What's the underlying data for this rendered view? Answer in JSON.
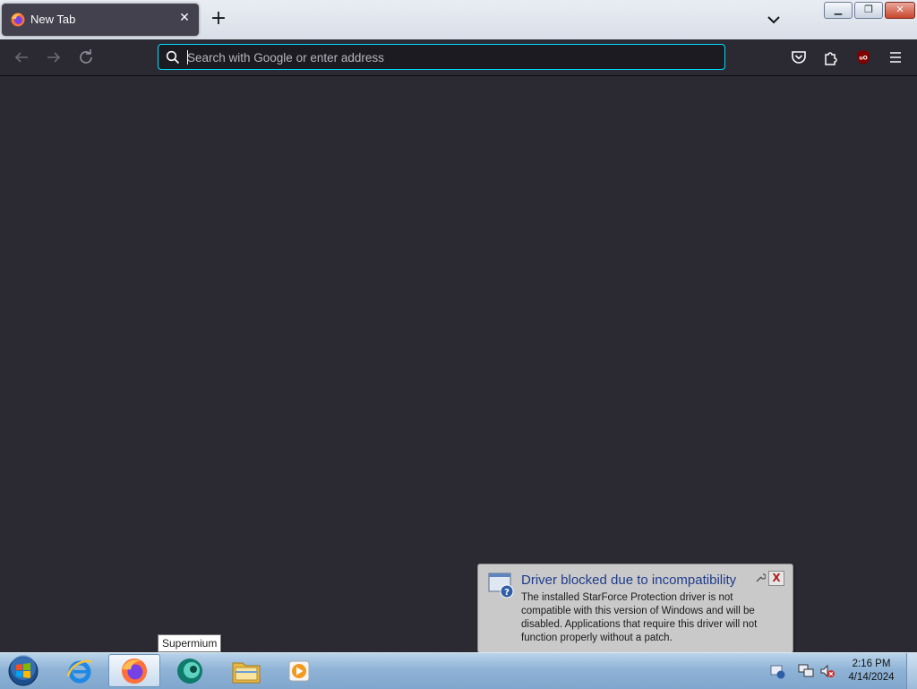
{
  "browser": {
    "tab": {
      "title": "New Tab",
      "close_glyph": "✕",
      "icon": "firefox-icon"
    },
    "new_tab_glyph": "+",
    "urlbar": {
      "placeholder": "Search with Google or enter address",
      "value": ""
    },
    "accent": "#00ddff",
    "theme_bg": "#2b2a33"
  },
  "window_controls": {
    "minimize": "▁",
    "restore": "❐",
    "close": "✕"
  },
  "notification": {
    "title": "Driver blocked due to incompatibility",
    "body": "The installed StarForce Protection driver is not compatible with this version of Windows and will be disabled.  Applications that require this driver will not function properly without a patch.",
    "close_glyph": "X"
  },
  "tooltip": {
    "text": "Supermium"
  },
  "taskbar": {
    "items": [
      {
        "name": "internet-explorer",
        "icon": "ie-icon"
      },
      {
        "name": "firefox",
        "icon": "firefox-icon",
        "active": true
      },
      {
        "name": "supermium",
        "icon": "supermium-icon"
      },
      {
        "name": "explorer",
        "icon": "folder-icon"
      },
      {
        "name": "media-player",
        "icon": "media-player-icon"
      }
    ],
    "clock": {
      "time": "2:16 PM",
      "date": "4/14/2024"
    }
  }
}
